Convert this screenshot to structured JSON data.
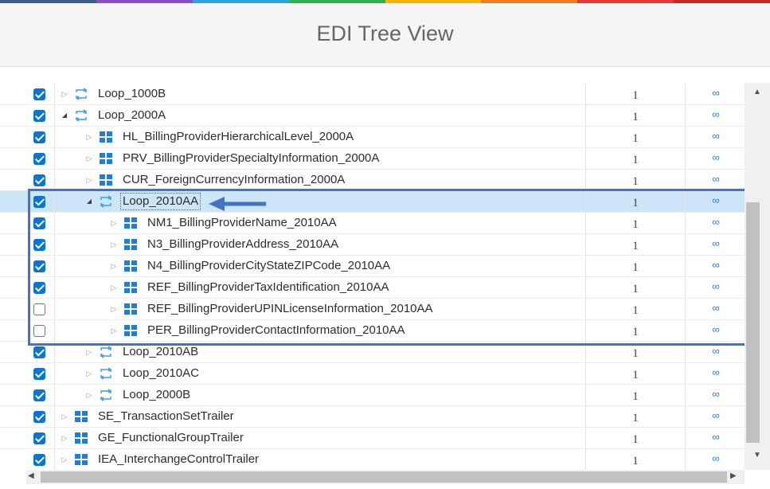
{
  "accent_colors": [
    "#3b5a8a",
    "#8b4fc5",
    "#2aa3df",
    "#2fb14f",
    "#f4b400",
    "#ef7d22",
    "#e53935",
    "#c62828"
  ],
  "header": {
    "title": "EDI Tree View"
  },
  "tree": {
    "expand_link_symbol": "∞",
    "rows": [
      {
        "name": "Loop_1000B",
        "count": "1",
        "checked": true,
        "level": 0,
        "type": "loop",
        "expanded": false
      },
      {
        "name": "Loop_2000A",
        "count": "1",
        "checked": true,
        "level": 0,
        "type": "loop",
        "expanded": true
      },
      {
        "name": "HL_BillingProviderHierarchicalLevel_2000A",
        "count": "1",
        "checked": true,
        "level": 1,
        "type": "segment",
        "expanded": false
      },
      {
        "name": "PRV_BillingProviderSpecialtyInformation_2000A",
        "count": "1",
        "checked": true,
        "level": 1,
        "type": "segment",
        "expanded": false
      },
      {
        "name": "CUR_ForeignCurrencyInformation_2000A",
        "count": "1",
        "checked": true,
        "level": 1,
        "type": "segment",
        "expanded": false
      },
      {
        "name": "Loop_2010AA",
        "count": "1",
        "checked": true,
        "level": 1,
        "type": "loop",
        "expanded": true,
        "selected": true
      },
      {
        "name": "NM1_BillingProviderName_2010AA",
        "count": "1",
        "checked": true,
        "level": 2,
        "type": "segment",
        "expanded": false
      },
      {
        "name": "N3_BillingProviderAddress_2010AA",
        "count": "1",
        "checked": true,
        "level": 2,
        "type": "segment",
        "expanded": false
      },
      {
        "name": "N4_BillingProviderCityStateZIPCode_2010AA",
        "count": "1",
        "checked": true,
        "level": 2,
        "type": "segment",
        "expanded": false
      },
      {
        "name": "REF_BillingProviderTaxIdentification_2010AA",
        "count": "1",
        "checked": true,
        "level": 2,
        "type": "segment",
        "expanded": false
      },
      {
        "name": "REF_BillingProviderUPINLicenseInformation_2010AA",
        "count": "1",
        "checked": false,
        "level": 2,
        "type": "segment",
        "expanded": false
      },
      {
        "name": "PER_BillingProviderContactInformation_2010AA",
        "count": "1",
        "checked": false,
        "level": 2,
        "type": "segment",
        "expanded": false
      },
      {
        "name": "Loop_2010AB",
        "count": "1",
        "checked": true,
        "level": 1,
        "type": "loop",
        "expanded": false
      },
      {
        "name": "Loop_2010AC",
        "count": "1",
        "checked": true,
        "level": 1,
        "type": "loop",
        "expanded": false
      },
      {
        "name": "Loop_2000B",
        "count": "1",
        "checked": true,
        "level": 1,
        "type": "loop",
        "expanded": false
      },
      {
        "name": "SE_TransactionSetTrailer",
        "count": "1",
        "checked": true,
        "level": 0,
        "type": "segment",
        "expanded": false
      },
      {
        "name": "GE_FunctionalGroupTrailer",
        "count": "1",
        "checked": true,
        "level": 0,
        "type": "segment",
        "expanded": false
      },
      {
        "name": "IEA_InterchangeControlTrailer",
        "count": "1",
        "checked": true,
        "level": 0,
        "type": "segment",
        "expanded": false
      }
    ]
  },
  "colors": {
    "loop_icon": "#3aa0e0",
    "segment_icon": "#1f7fd6",
    "selected_row": "#cde6f7",
    "highlight_box": "#4472c4",
    "arrow": "#4472c4"
  }
}
